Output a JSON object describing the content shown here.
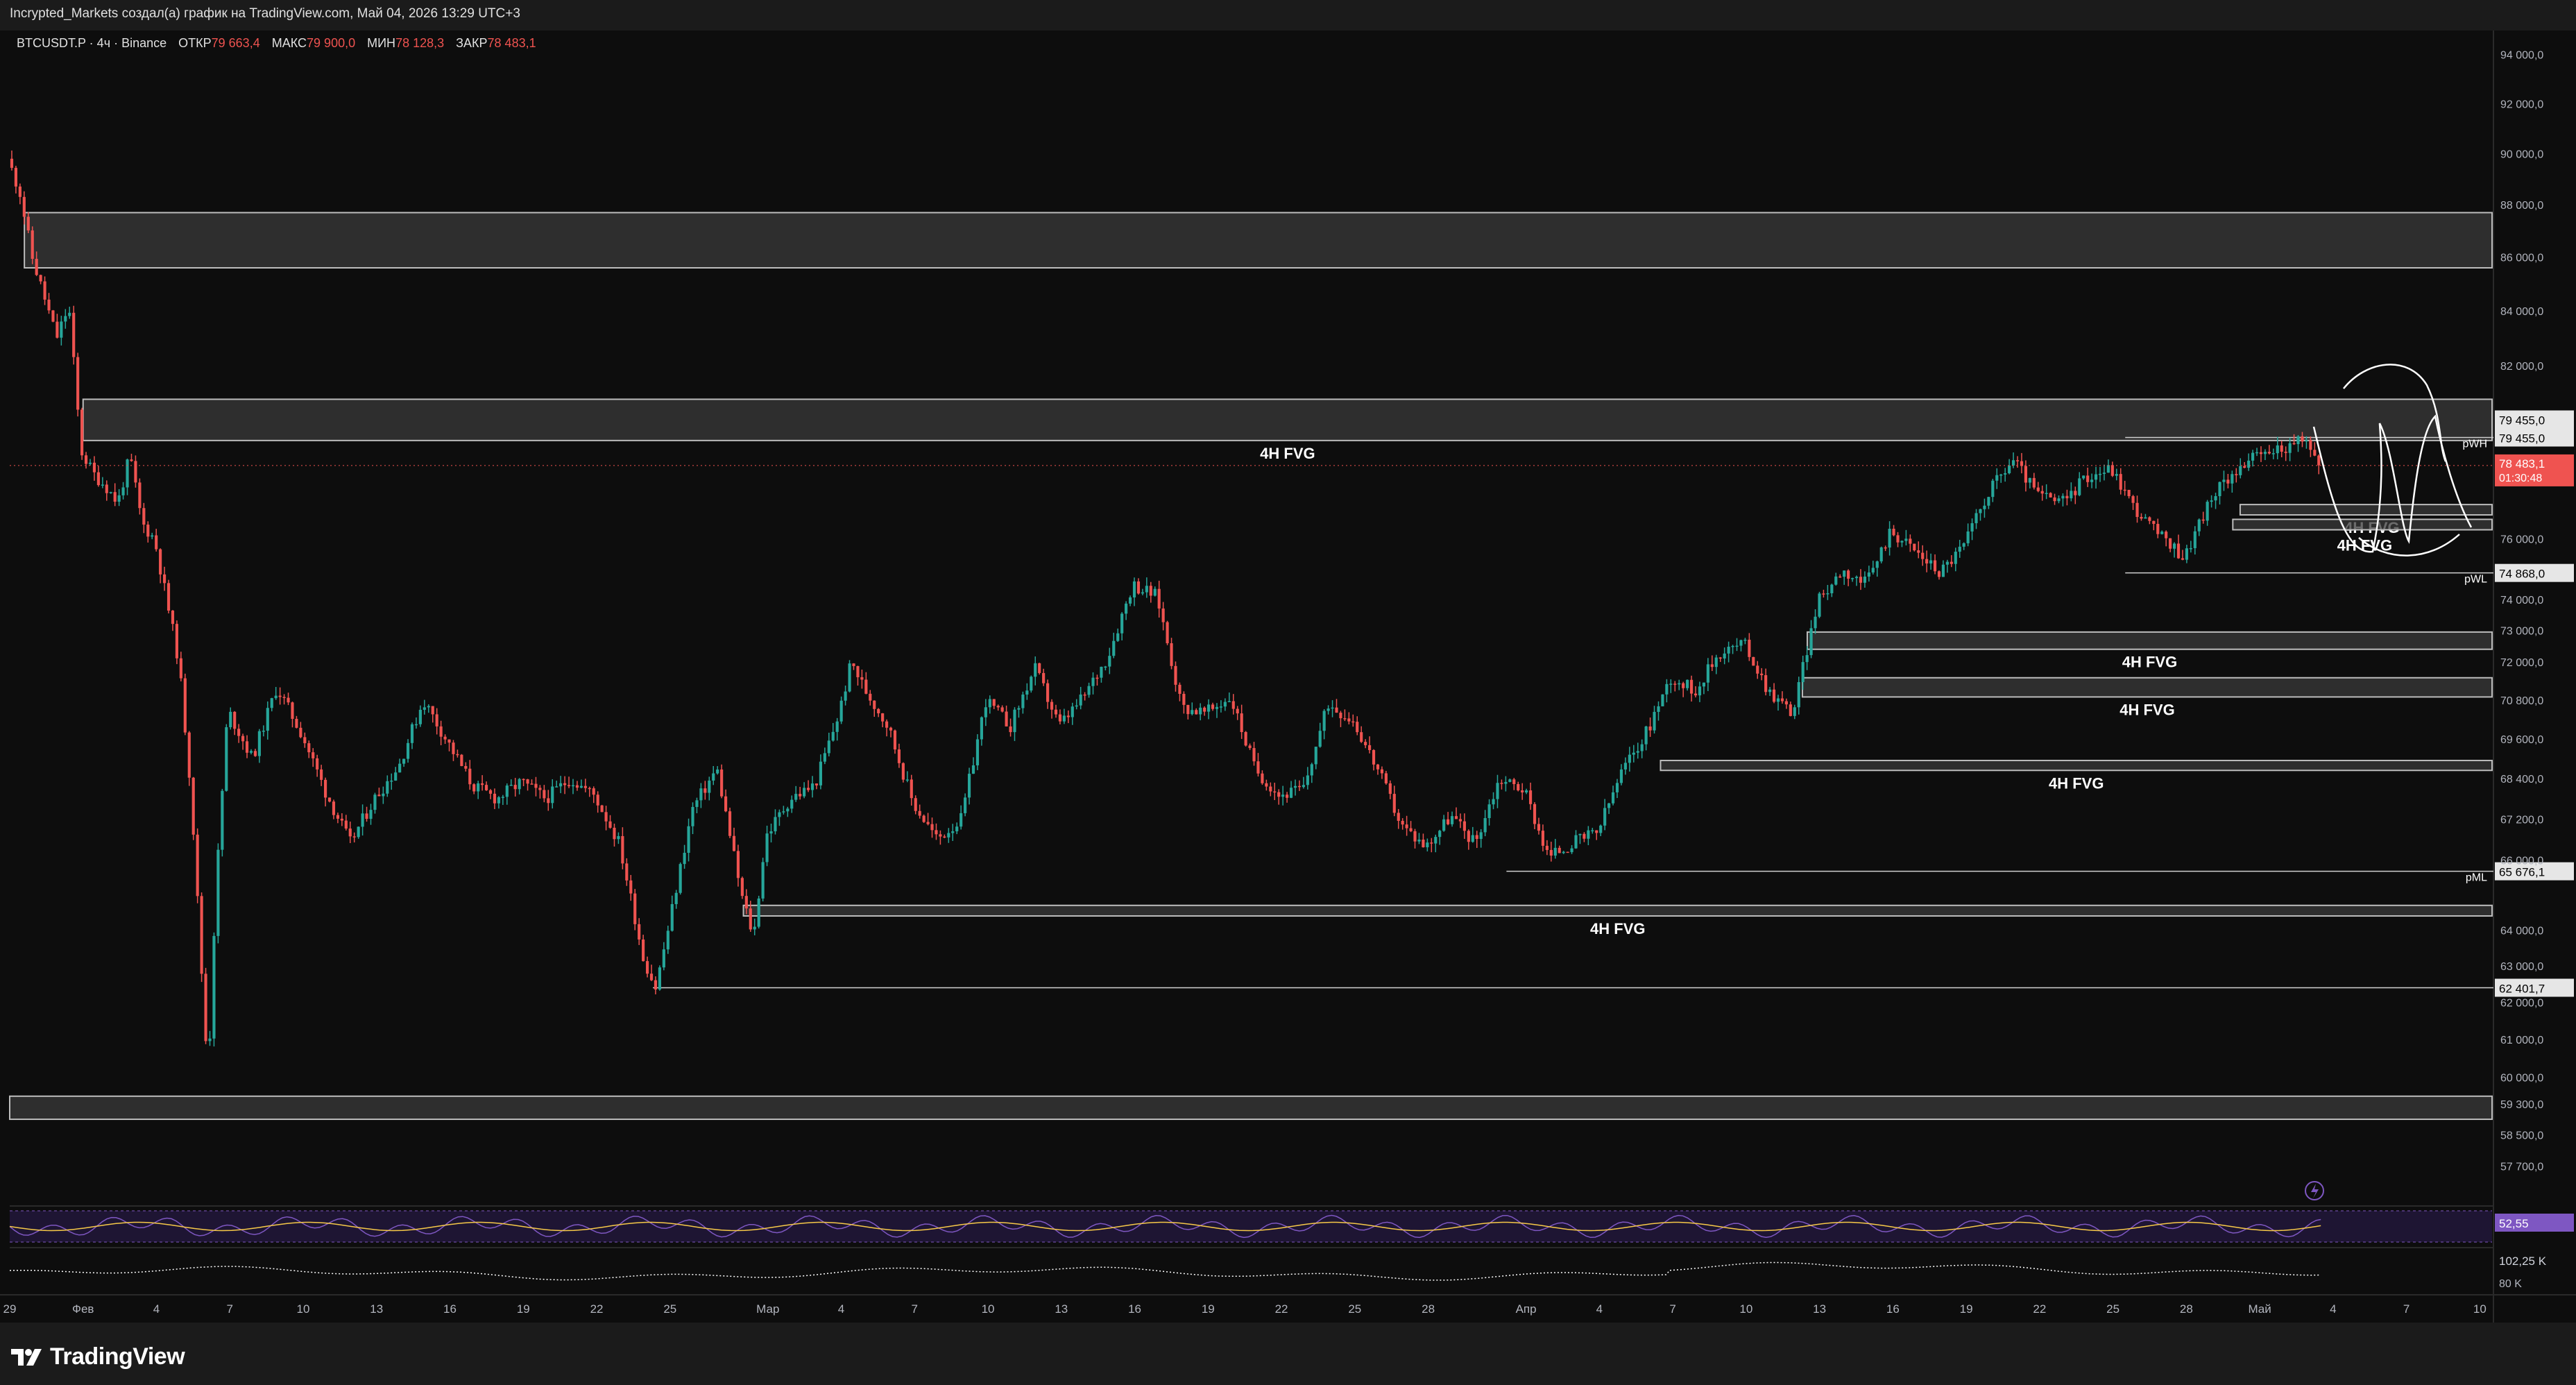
{
  "header": {
    "title": "Incrypted_Markets создал(а) график на TradingView.com, Май 04, 2026 13:29 UTC+3"
  },
  "legend": {
    "symbol": "BTCUSDT.P · 4ч · Binance",
    "open_label": "ОТКР",
    "open_value": "79 663,4",
    "high_label": "МАКС",
    "high_value": "79 900,0",
    "low_label": "МИН",
    "low_value": "78 128,3",
    "close_label": "ЗАКР",
    "close_value": "78 483,1"
  },
  "footer": {
    "logo_text": "TradingView"
  },
  "colors": {
    "background": "#0d0d0d",
    "up": "#26a69a",
    "down": "#ef5350",
    "zone_fill": "#3a3a3a",
    "zone_border": "#bdbdbd",
    "price_tag": "#ef5350",
    "rsi_line": "#7e57c2",
    "rsi_ma": "#f7c948"
  },
  "chart_data": {
    "type": "candlestick",
    "symbol": "BTCUSDT.P",
    "timeframe": "4ч",
    "exchange": "Binance",
    "y_scale": "log",
    "ylim": [
      56700,
      95000
    ],
    "y_ticks": [
      "94 000,0",
      "92 000,0",
      "90 000,0",
      "88 000,0",
      "86 000,0",
      "84 000,0",
      "82 000,0",
      "76 000,0",
      "74 000,0",
      "73 000,0",
      "72 000,0",
      "70 800,0",
      "69 600,0",
      "68 400,0",
      "67 200,0",
      "66 000,0",
      "64 000,0",
      "63 000,0",
      "62 000,0",
      "61 000,0",
      "60 000,0",
      "59 300,0",
      "58 500,0",
      "57 700,0"
    ],
    "y_tick_values": [
      94000,
      92000,
      90000,
      88000,
      86000,
      84000,
      82000,
      76000,
      74000,
      73000,
      72000,
      70800,
      69600,
      68400,
      67200,
      66000,
      64000,
      63000,
      62000,
      61000,
      60000,
      59300,
      58500,
      57700
    ],
    "x_range_days": [
      0,
      101.5
    ],
    "x_ticks": [
      "29",
      "Фев",
      "4",
      "7",
      "10",
      "13",
      "16",
      "19",
      "22",
      "25",
      "Мар",
      "4",
      "7",
      "10",
      "13",
      "16",
      "19",
      "22",
      "25",
      "28",
      "Апр",
      "4",
      "7",
      "10",
      "13",
      "16",
      "19",
      "22",
      "25",
      "28",
      "Май",
      "4",
      "7",
      "10"
    ],
    "x_tick_days": [
      0,
      3,
      6,
      9,
      12,
      15,
      18,
      21,
      24,
      27,
      31,
      34,
      37,
      40,
      43,
      46,
      49,
      52,
      55,
      58,
      62,
      65,
      68,
      71,
      74,
      77,
      80,
      83,
      86,
      89,
      92,
      95,
      98,
      101
    ],
    "price_path": [
      [
        0,
        89800
      ],
      [
        0.5,
        88500
      ],
      [
        1,
        86000
      ],
      [
        1.5,
        84500
      ],
      [
        2,
        83000
      ],
      [
        2.5,
        84200
      ],
      [
        3,
        79000
      ],
      [
        3.5,
        78200
      ],
      [
        4,
        77800
      ],
      [
        4.5,
        77200
      ],
      [
        5,
        78800
      ],
      [
        5.5,
        76500
      ],
      [
        6,
        76000
      ],
      [
        6.5,
        74000
      ],
      [
        7,
        72000
      ],
      [
        7.5,
        68000
      ],
      [
        8,
        62000
      ],
      [
        8.2,
        60000
      ],
      [
        8.5,
        65000
      ],
      [
        9,
        70500
      ],
      [
        10,
        69000
      ],
      [
        11,
        71200
      ],
      [
        12,
        69800
      ],
      [
        13,
        68000
      ],
      [
        14,
        66500
      ],
      [
        15,
        67800
      ],
      [
        16,
        68800
      ],
      [
        17,
        70800
      ],
      [
        18,
        69500
      ],
      [
        19,
        68200
      ],
      [
        20,
        67800
      ],
      [
        21,
        68300
      ],
      [
        22,
        67800
      ],
      [
        23,
        68400
      ],
      [
        24,
        67900
      ],
      [
        25,
        66500
      ],
      [
        26,
        63200
      ],
      [
        26.5,
        62400
      ],
      [
        27,
        64000
      ],
      [
        28,
        67500
      ],
      [
        29,
        68700
      ],
      [
        30,
        65000
      ],
      [
        30.5,
        63800
      ],
      [
        31,
        66700
      ],
      [
        32,
        67800
      ],
      [
        33,
        68200
      ],
      [
        34,
        70400
      ],
      [
        34.5,
        72000
      ],
      [
        35,
        71200
      ],
      [
        36,
        70000
      ],
      [
        37,
        67700
      ],
      [
        38,
        66600
      ],
      [
        39,
        67200
      ],
      [
        40,
        70800
      ],
      [
        41,
        70000
      ],
      [
        42,
        71800
      ],
      [
        43,
        70000
      ],
      [
        44,
        70900
      ],
      [
        45,
        72200
      ],
      [
        46,
        74500
      ],
      [
        47,
        74100
      ],
      [
        48,
        70600
      ],
      [
        49,
        70400
      ],
      [
        50,
        70900
      ],
      [
        51,
        68700
      ],
      [
        52,
        67900
      ],
      [
        53,
        68100
      ],
      [
        54,
        70700
      ],
      [
        55,
        70200
      ],
      [
        56,
        68700
      ],
      [
        57,
        67000
      ],
      [
        58,
        66400
      ],
      [
        59,
        67300
      ],
      [
        60,
        66500
      ],
      [
        61,
        68400
      ],
      [
        62,
        68100
      ],
      [
        63,
        66100
      ],
      [
        64,
        66500
      ],
      [
        65,
        66800
      ],
      [
        66,
        68600
      ],
      [
        67,
        69800
      ],
      [
        68,
        71500
      ],
      [
        69,
        71100
      ],
      [
        70,
        72300
      ],
      [
        71,
        72600
      ],
      [
        72,
        71100
      ],
      [
        73,
        70400
      ],
      [
        74,
        73900
      ],
      [
        75,
        75000
      ],
      [
        76,
        74500
      ],
      [
        77,
        76300
      ],
      [
        78,
        75600
      ],
      [
        79,
        74900
      ],
      [
        80,
        75800
      ],
      [
        81,
        77600
      ],
      [
        82,
        78700
      ],
      [
        83,
        77500
      ],
      [
        84,
        77200
      ],
      [
        85,
        78100
      ],
      [
        86,
        78400
      ],
      [
        87,
        77000
      ],
      [
        88,
        76100
      ],
      [
        89,
        75400
      ],
      [
        90,
        77200
      ],
      [
        91,
        78300
      ],
      [
        92,
        78800
      ],
      [
        93,
        79100
      ],
      [
        94,
        79350
      ],
      [
        94.5,
        78483
      ]
    ],
    "zones": [
      {
        "label": "",
        "x0": 0.6,
        "x1": 101.5,
        "y_low": 85600,
        "y_high": 87700
      },
      {
        "label": "4H FVG",
        "x0": 3.0,
        "x1": 101.5,
        "y_low": 79350,
        "y_high": 80800
      },
      {
        "label": "",
        "x0": 0,
        "x1": 101.5,
        "y_low": 58900,
        "y_high": 59500
      },
      {
        "label": "4H FVG",
        "x0": 30.0,
        "x1": 101.5,
        "y_low": 64400,
        "y_high": 64700
      },
      {
        "label": "4H FVG",
        "x0": 73.5,
        "x1": 101.5,
        "y_low": 72400,
        "y_high": 72950
      },
      {
        "label": "4H FVG",
        "x0": 73.3,
        "x1": 101.5,
        "y_low": 70900,
        "y_high": 71500
      },
      {
        "label": "4H FVG",
        "x0": 67.5,
        "x1": 101.5,
        "y_low": 68650,
        "y_high": 68950
      },
      {
        "label": "4H FVG",
        "x0": 91.2,
        "x1": 101.5,
        "y_low": 76800,
        "y_high": 77150
      },
      {
        "label": "4H FVG",
        "x0": 90.9,
        "x1": 101.5,
        "y_low": 76300,
        "y_high": 76650
      }
    ],
    "levels": [
      {
        "label": "pWH",
        "price_tag": "79 455,0",
        "value": 79455,
        "x0": 86.5
      },
      {
        "label": "pWL",
        "price_tag": "74 868,0",
        "value": 74868,
        "x0": 86.5
      },
      {
        "label": "pML",
        "price_tag": "65 676,1",
        "value": 65676,
        "x0": 61.2
      },
      {
        "label": "",
        "price_tag": "62 401,7",
        "value": 62401.7,
        "x0": 26.3
      }
    ],
    "extra_price_tag": "79 455,0",
    "last_price": {
      "value": 78483.1,
      "label": "78 483,1",
      "countdown": "01:30:48"
    },
    "indicators": {
      "rsi": {
        "value_label": "52,55",
        "value": 52.55
      },
      "volume": {
        "value_label": "102,25 K",
        "scale_label": "80 K"
      }
    }
  }
}
